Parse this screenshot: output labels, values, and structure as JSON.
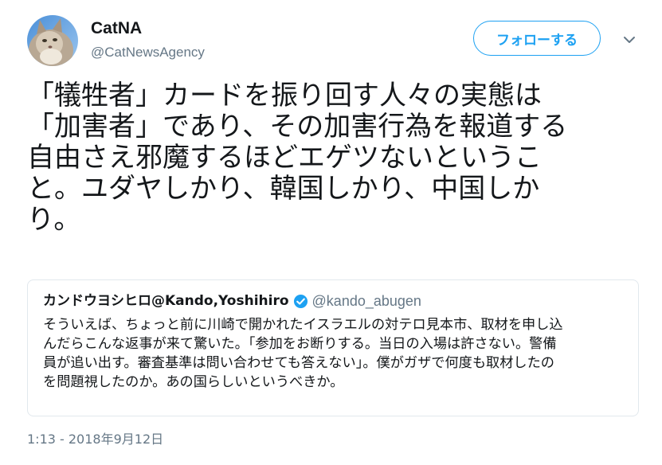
{
  "tweet": {
    "author": {
      "display_name": "CatNA",
      "handle": "@CatNewsAgency",
      "avatar_icon": "cat-avatar"
    },
    "follow_label": "フォローする",
    "menu_icon": "chevron-down-icon",
    "text": "「犠牲者」カードを振り回す人々の実態は\n「加害者」であり、その加害行為を報道する\n自由さえ邪魔するほどエゲツないというこ\nと。ユダヤしかり、韓国しかり、中国しか\nり。",
    "timestamp": "1:13 - 2018年9月12日"
  },
  "quoted_tweet": {
    "display_name": "カンドウヨシヒロ@Kando,Yoshihiro",
    "verified": true,
    "handle": "@kando_abugen",
    "text": "そういえば、ちょっと前に川崎で開かれたイスラエルの対テロ見本市、取材を申し込\nんだらこんな返事が来て驚いた。「参加をお断りする。当日の入場は許さない。警備\n員が追い出す。審査基準は問い合わせても答えない」。僕がガザで何度も取材したの\nを問題視したのか。あの国らしいというべきか。"
  },
  "colors": {
    "accent": "#1da1f2",
    "text": "#14171a",
    "secondary": "#657786",
    "border": "#e1e8ed"
  }
}
